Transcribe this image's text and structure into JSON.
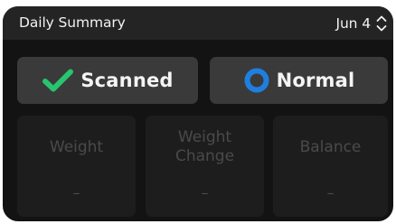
{
  "header": {
    "title": "Daily Summary",
    "date": "Jun 4",
    "date_picker_icon": "chevron-up-down-icon"
  },
  "status": {
    "scanned": {
      "label": "Scanned",
      "icon": "checkmark-icon",
      "color": "#28c46e"
    },
    "normal": {
      "label": "Normal",
      "icon": "ring-icon",
      "color": "#1f7fe0"
    }
  },
  "metrics": [
    {
      "label_lines": [
        "Weight"
      ],
      "value": "–"
    },
    {
      "label_lines": [
        "Weight",
        "Change"
      ],
      "value": "–"
    },
    {
      "label_lines": [
        "Balance"
      ],
      "value": "–"
    }
  ],
  "colors": {
    "card_bg": "#131313",
    "header_bg": "#242424",
    "pill_bg": "#3a3a3a",
    "metric_bg": "#1d1d1d",
    "muted_text": "#4a4a4a"
  }
}
